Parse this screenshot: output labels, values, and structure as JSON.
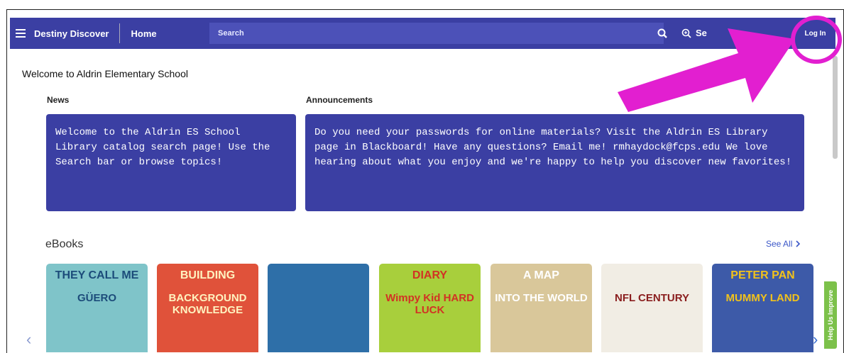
{
  "navbar": {
    "brand": "Destiny Discover",
    "home": "Home",
    "search_placeholder": "Search",
    "adv_search": "Se",
    "login": "Log In"
  },
  "page": {
    "welcome": "Welcome to Aldrin Elementary School"
  },
  "news": {
    "title": "News",
    "body": "Welcome to the Aldrin ES School Library catalog search page! Use the Search bar or browse topics!"
  },
  "announcements": {
    "title": "Announcements",
    "body": "Do you need your passwords for online materials? Visit the Aldrin ES Library page in Blackboard! Have any questions? Email me! rmhaydock@fcps.edu We love hearing about what you enjoy and we're happy to help you discover new favorites!"
  },
  "ebooks": {
    "title": "eBooks",
    "see_all": "See All",
    "books": [
      {
        "line1": "THEY CALL ME",
        "line2": "GÜERO",
        "bg": "#7fc4c9",
        "fg": "#1c4c7a"
      },
      {
        "line1": "BUILDING",
        "line2": "BACKGROUND KNOWLEDGE",
        "bg": "#e0523a",
        "fg": "#fff3c0"
      },
      {
        "line1": "",
        "line2": "",
        "bg": "#2e6fa8",
        "fg": "#ffffff"
      },
      {
        "line1": "DIARY",
        "line2": "Wimpy Kid HARD LUCK",
        "bg": "#a8cf3c",
        "fg": "#d23224"
      },
      {
        "line1": "A MAP",
        "line2": "INTO THE WORLD",
        "bg": "#d9c79a",
        "fg": "#ffffff"
      },
      {
        "line1": "",
        "line2": "NFL CENTURY",
        "bg": "#f1ede4",
        "fg": "#8a1e1e"
      },
      {
        "line1": "PETER PAN",
        "line2": "MUMMY LAND",
        "bg": "#3d5aa8",
        "fg": "#f2c21b"
      }
    ]
  },
  "help_tab": "Help Us Improve",
  "colors": {
    "primary": "#3b3fa3",
    "annotation": "#e21fd0"
  }
}
